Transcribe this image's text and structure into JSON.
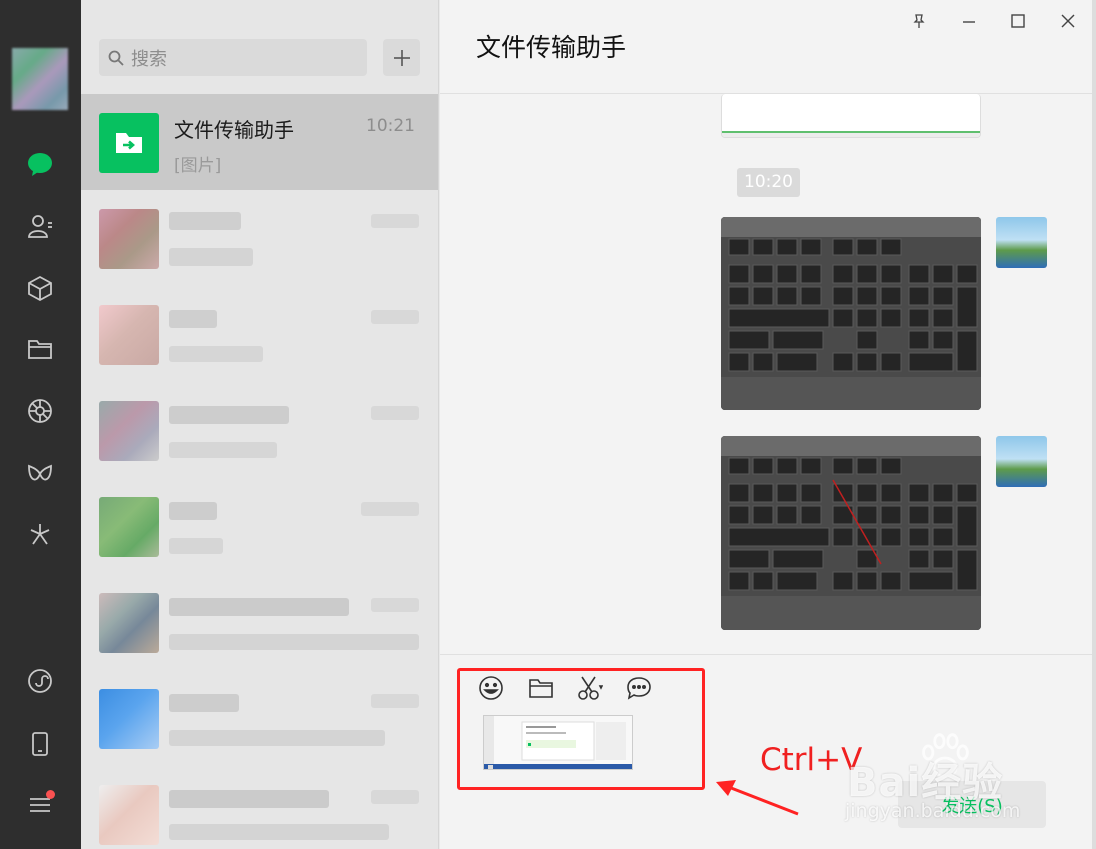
{
  "rail": {
    "icons": [
      "chat-icon",
      "contacts-icon",
      "favorites-icon",
      "files-icon",
      "moments-icon",
      "channels-icon",
      "search-discover-icon",
      "mini-programs-icon",
      "phone-icon",
      "menu-icon"
    ]
  },
  "list": {
    "search_placeholder": "搜索",
    "add_label": "+",
    "active_chat": {
      "name": "文件传输助手",
      "time": "10:21",
      "preview": "[图片]"
    }
  },
  "chat": {
    "title": "文件传输助手",
    "timestamp": "10:20",
    "send_label": "发送(S)"
  },
  "annotation": {
    "text": "Ctrl+V"
  },
  "watermark": {
    "brand": "Bai经验",
    "url": "jingyan.baidu.com"
  },
  "colors": {
    "rail_bg": "#2e2e2e",
    "accent_green": "#07c160",
    "annotation_red": "#f22222"
  }
}
